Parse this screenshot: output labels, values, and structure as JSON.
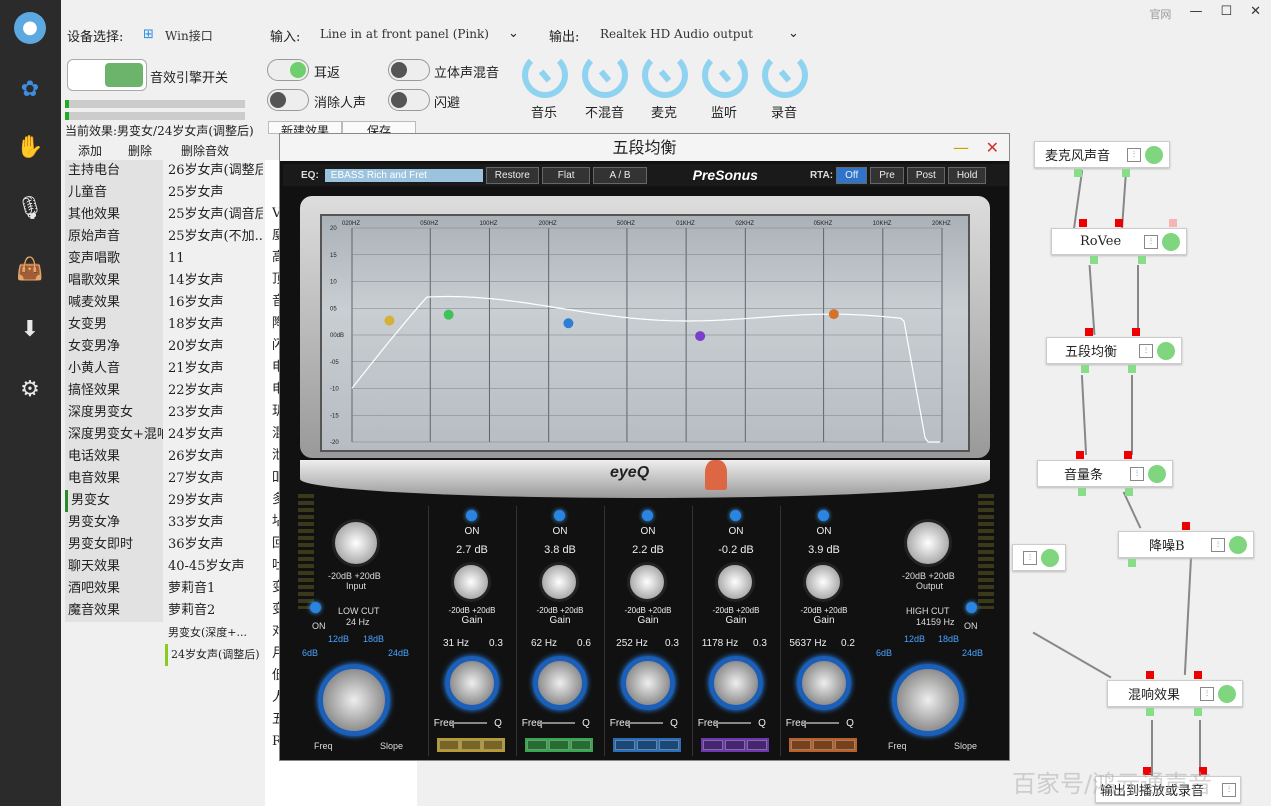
{
  "window": {
    "official_site": "官网",
    "minimize": "—",
    "maximize": "☐",
    "close": "✕"
  },
  "sidebar": {
    "icons": [
      "microphone-logo-icon",
      "flower-icon",
      "hand-icon",
      "mic-icon",
      "bag-icon",
      "download-icon",
      "settings-icon"
    ]
  },
  "header": {
    "device_label": "设备选择:",
    "device_value": "Win接口",
    "input_label": "输入:",
    "input_value": "Line in at front panel (Pink)",
    "output_label": "输出:",
    "output_value": "Realtek HD Audio output"
  },
  "engine_toggle": {
    "label": "音效引擎开关"
  },
  "toggles": [
    {
      "label": "耳返",
      "on": true
    },
    {
      "label": "立体声混音",
      "on": false
    },
    {
      "label": "消除人声",
      "on": false
    },
    {
      "label": "闪避",
      "on": false
    }
  ],
  "knobs": [
    "音乐",
    "不混音",
    "麦克",
    "监听",
    "录音"
  ],
  "current_effect": "当前效果:男变女/24岁女声(调整后)",
  "effect_actions": {
    "add": "添加",
    "delete": "删除",
    "delete_effect": "删除音效",
    "new_effect": "新建效果",
    "save": "保存"
  },
  "effects": [
    {
      "name": "主持电台",
      "preset": "26岁女声(调整后)"
    },
    {
      "name": "儿童音",
      "preset": "25岁女声"
    },
    {
      "name": "其他效果",
      "preset": "25岁女声(调音后)"
    },
    {
      "name": "原始声音",
      "preset": "25岁女声(不加..."
    },
    {
      "name": "变声唱歌",
      "preset": "11"
    },
    {
      "name": "唱歌效果",
      "preset": "14岁女声"
    },
    {
      "name": "喊麦效果",
      "preset": "16岁女声"
    },
    {
      "name": "女变男",
      "preset": "18岁女声"
    },
    {
      "name": "女变男净",
      "preset": "20岁女声"
    },
    {
      "name": "小黄人音",
      "preset": "21岁女声"
    },
    {
      "name": "搞怪效果",
      "preset": "22岁女声"
    },
    {
      "name": "深度男变女",
      "preset": "23岁女声"
    },
    {
      "name": "深度男变女+混响",
      "preset": "24岁女声"
    },
    {
      "name": "电话效果",
      "preset": "26岁女声"
    },
    {
      "name": "电音效果",
      "preset": "27岁女声"
    },
    {
      "name": "男变女",
      "preset": "29岁女声"
    },
    {
      "name": "男变女净",
      "preset": "33岁女声"
    },
    {
      "name": "男变女即时",
      "preset": "36岁女声"
    },
    {
      "name": "聊天效果",
      "preset": "40-45岁女声"
    },
    {
      "name": "酒吧效果",
      "preset": "萝莉音1"
    },
    {
      "name": "魔音效果",
      "preset": "萝莉音2"
    },
    {
      "name": "",
      "preset": "男变女(深度+..."
    },
    {
      "name": "",
      "preset": "24岁女声(调整后)"
    }
  ],
  "partial_list": [
    "V",
    "廋",
    "高",
    "顶",
    "音",
    "陶",
    "闪",
    "电",
    "电",
    "玑",
    "混",
    "泄",
    "吅",
    "多",
    "坫",
    "回",
    "吐",
    "变",
    "变",
    "对",
    "月",
    "低",
    "人",
    "五",
    "R"
  ],
  "eq": {
    "title": "五段均衡",
    "eq_label": "EQ:",
    "preset": "EBASS Rich and Fret",
    "restore": "Restore",
    "flat": "Flat",
    "ab": "A / B",
    "brand": "PreSonus",
    "rta_label": "RTA:",
    "rta_off": "Off",
    "rta_pre": "Pre",
    "rta_post": "Post",
    "rta_hold": "Hold",
    "freq_ticks": [
      "020HZ",
      "050HZ",
      "100HZ",
      "200HZ",
      "500HZ",
      "01KHZ",
      "02KHZ",
      "05KHZ",
      "10KHZ",
      "20KHZ"
    ],
    "db_ticks": [
      "20",
      "15",
      "10",
      "05",
      "00dB",
      "-05",
      "-10",
      "-15",
      "-20"
    ],
    "logo": "eyeQ",
    "input": {
      "label": "Input",
      "range": "-20dB  +20dB"
    },
    "output": {
      "label": "Output",
      "range": "-20dB  +20dB"
    },
    "low_cut": {
      "title": "LOW CUT",
      "freq": "24 Hz",
      "on": "ON",
      "slopes": [
        "6dB",
        "12dB",
        "18dB",
        "24dB"
      ],
      "freq_label": "Freq",
      "slope_label": "Slope"
    },
    "high_cut": {
      "title": "HIGH CUT",
      "freq": "14159 Hz",
      "on": "ON",
      "slopes": [
        "6dB",
        "12dB",
        "18dB",
        "24dB"
      ],
      "freq_label": "Freq",
      "slope_label": "Slope"
    },
    "bands": [
      {
        "on": "ON",
        "gain": "2.7 dB",
        "freq": "31 Hz",
        "q": "0.3",
        "color": "#d4b23a"
      },
      {
        "on": "ON",
        "gain": "3.8 dB",
        "freq": "62 Hz",
        "q": "0.6",
        "color": "#3fc25a"
      },
      {
        "on": "ON",
        "gain": "2.2 dB",
        "freq": "252 Hz",
        "q": "0.3",
        "color": "#2d7fd6"
      },
      {
        "on": "ON",
        "gain": "-0.2 dB",
        "freq": "1178 Hz",
        "q": "0.3",
        "color": "#7c3fc9"
      },
      {
        "on": "ON",
        "gain": "3.9 dB",
        "freq": "5637 Hz",
        "q": "0.2",
        "color": "#d6702d"
      }
    ],
    "gain_range": "-20dB  +20dB",
    "gain_label": "Gain",
    "freq_label": "Freq",
    "q_label": "Q"
  },
  "nodes": [
    "麦克风声音",
    "RoVee",
    "五段均衡",
    "音量条",
    "降噪B",
    "混响效果",
    "输出到播放或录音"
  ],
  "watermark": "百家号/鸿元通声音"
}
